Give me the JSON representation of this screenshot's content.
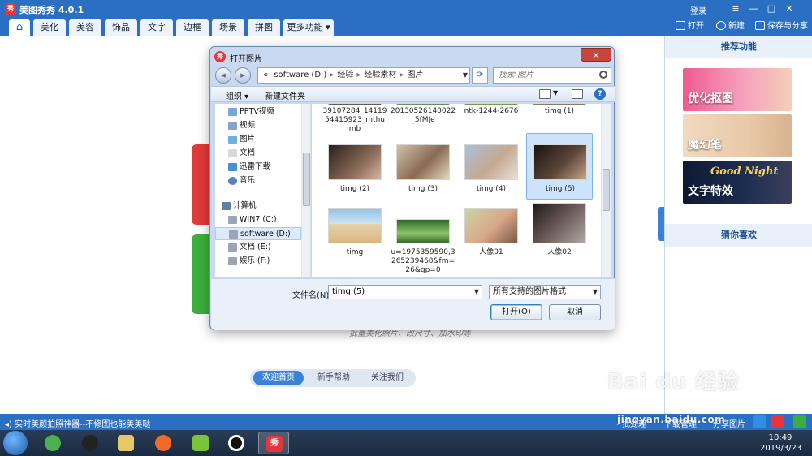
{
  "app": {
    "title": "美图秀秀 4.0.1",
    "logo_text": "秀",
    "login": "登录",
    "window_controls": [
      "≡",
      "—",
      "□",
      "✕"
    ]
  },
  "nav": {
    "tabs": [
      "美化",
      "美容",
      "饰品",
      "文字",
      "边框",
      "场景",
      "拼图",
      "更多功能 ▾"
    ],
    "home_icon": "home-icon",
    "actions": [
      "打开",
      "新建",
      "保存与分享"
    ]
  },
  "main": {
    "handwriting": "批量美化照片、改尺寸、加水印等",
    "bottom_tabs": [
      "欢迎首页",
      "新手帮助",
      "关注我们"
    ]
  },
  "right_panel": {
    "recommend_title": "推荐功能",
    "banners": [
      "优化抠图",
      "魔幻笔",
      "文字特效"
    ],
    "banner3_script": "Good Night",
    "guess_title": "猜你喜欢"
  },
  "statusbar": {
    "tip": "实时美颜拍照神器--不修图也能美美哒",
    "buttons": [
      "批处理",
      "下载管理",
      "分享图片"
    ]
  },
  "taskbar": {
    "time": "10:49",
    "date": "2019/3/23",
    "active_app": "秀"
  },
  "dialog": {
    "title": "打开图片",
    "close": "✕",
    "address": {
      "prefix": "«",
      "segments": [
        "software (D:)",
        "经验",
        "经验素材",
        "图片"
      ]
    },
    "search_placeholder": "搜索 图片",
    "cmd": {
      "organize": "组织 ▾",
      "new_folder": "新建文件夹"
    },
    "tree": [
      {
        "label": "PPTV视频",
        "icon": "video-folder-icon"
      },
      {
        "label": "视频",
        "icon": "video-icon"
      },
      {
        "label": "图片",
        "icon": "picture-icon"
      },
      {
        "label": "文档",
        "icon": "document-icon"
      },
      {
        "label": "迅雷下载",
        "icon": "download-icon"
      },
      {
        "label": "音乐",
        "icon": "music-icon"
      },
      {
        "label": "计算机",
        "icon": "computer-icon"
      },
      {
        "label": "WIN7 (C:)",
        "icon": "drive-icon"
      },
      {
        "label": "software (D:)",
        "icon": "drive-icon"
      },
      {
        "label": "文档 (E:)",
        "icon": "drive-icon"
      },
      {
        "label": "娱乐 (F:)",
        "icon": "drive-icon"
      }
    ],
    "files": [
      {
        "name": "39107284_1411954415923_mthumb"
      },
      {
        "name": "20130526140022_5fMJe"
      },
      {
        "name": "ntk-1244-2676"
      },
      {
        "name": "timg (1)"
      },
      {
        "name": "timg (2)"
      },
      {
        "name": "timg (3)"
      },
      {
        "name": "timg (4)"
      },
      {
        "name": "timg (5)"
      },
      {
        "name": "timg"
      },
      {
        "name": "u=1975359590,3265239468&fm=26&gp=0"
      },
      {
        "name": "人像01"
      },
      {
        "name": "人像02"
      }
    ],
    "filename_label": "文件名(N):",
    "filename_value": "timg (5)",
    "filetype": "所有支持的图片格式",
    "open_button": "打开(O)",
    "cancel_button": "取消"
  },
  "watermark": {
    "text": "Bai du 经验",
    "sub": "jingyan.baidu.com"
  },
  "colors": {
    "chrome_blue": "#2b6fc3",
    "accent_red": "#e03a3a",
    "accent_green": "#3cae3c"
  }
}
